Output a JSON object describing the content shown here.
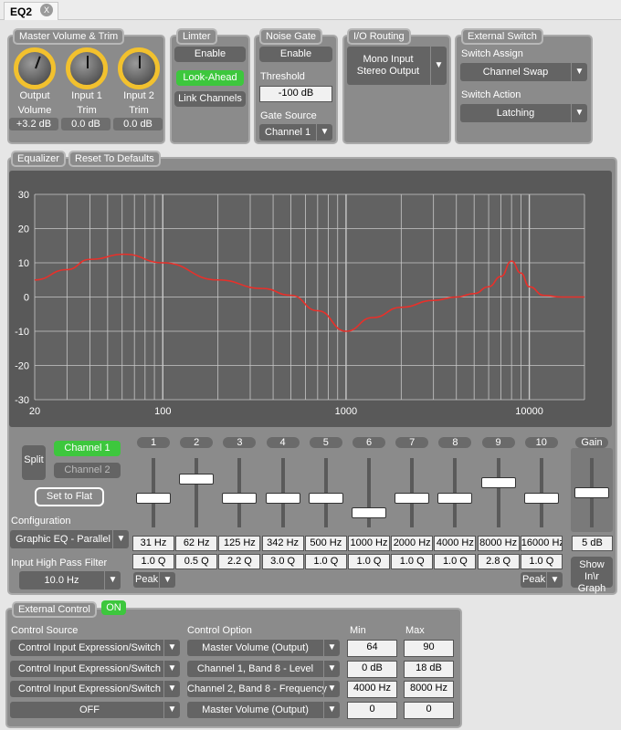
{
  "tab": {
    "title": "EQ2",
    "close": "X"
  },
  "master": {
    "title": "Master Volume & Trim",
    "knobs": [
      {
        "l1": "Output",
        "l2": "Volume",
        "value": "+3.2 dB",
        "angle": 20
      },
      {
        "l1": "Input 1",
        "l2": "Trim",
        "value": "0.0 dB",
        "angle": 0
      },
      {
        "l1": "Input 2",
        "l2": "Trim",
        "value": "0.0 dB",
        "angle": 0
      }
    ]
  },
  "limiter": {
    "title": "Limter",
    "enable": "Enable",
    "lookahead": "Look-Ahead",
    "link": "Link Channels"
  },
  "gate": {
    "title": "Noise Gate",
    "enable": "Enable",
    "threshold_label": "Threshold",
    "threshold": "-100 dB",
    "source_label": "Gate Source",
    "source": "Channel 1"
  },
  "io": {
    "title": "I/O Routing",
    "line1": "Mono Input",
    "line2": "Stereo Output"
  },
  "ext_switch": {
    "title": "External Switch",
    "assign_label": "Switch Assign",
    "assign": "Channel Swap",
    "action_label": "Switch Action",
    "action": "Latching"
  },
  "eq": {
    "title": "Equalizer",
    "reset": "Reset To Defaults",
    "split": "Split",
    "ch1": "Channel 1",
    "ch2": "Channel 2",
    "flat": "Set to Flat",
    "config_label": "Configuration",
    "config": "Graphic EQ - Parallel",
    "hpf_label": "Input High Pass Filter",
    "hpf": "10.0 Hz",
    "gain_label": "Gain",
    "gain": "5 dB",
    "gain_pos": 0.6,
    "show_graph": "Show In\\r Graph",
    "peak": "Peak",
    "bands": [
      {
        "n": "1",
        "f": "31 Hz",
        "q": "1.0 Q",
        "pos": 0.5
      },
      {
        "n": "2",
        "f": "62 Hz",
        "q": "0.5 Q",
        "pos": 0.83
      },
      {
        "n": "3",
        "f": "125 Hz",
        "q": "2.2 Q",
        "pos": 0.5
      },
      {
        "n": "4",
        "f": "342 Hz",
        "q": "3.0 Q",
        "pos": 0.5
      },
      {
        "n": "5",
        "f": "500 Hz",
        "q": "1.0 Q",
        "pos": 0.5
      },
      {
        "n": "6",
        "f": "1000 Hz",
        "q": "1.0 Q",
        "pos": 0.25
      },
      {
        "n": "7",
        "f": "2000 Hz",
        "q": "1.0 Q",
        "pos": 0.5
      },
      {
        "n": "8",
        "f": "4000 Hz",
        "q": "1.0 Q",
        "pos": 0.5
      },
      {
        "n": "9",
        "f": "8000 Hz",
        "q": "2.8 Q",
        "pos": 0.77
      },
      {
        "n": "10",
        "f": "16000 Hz",
        "q": "1.0 Q",
        "pos": 0.5
      }
    ]
  },
  "chart_data": {
    "type": "line",
    "xscale": "log",
    "xlim": [
      20,
      20000
    ],
    "ylim": [
      -30,
      30
    ],
    "grid": true,
    "yticks": [
      "30",
      "20",
      "10",
      "0",
      "-10",
      "-20",
      "-30"
    ],
    "xticks": [
      "20",
      "100",
      "1000",
      "10000"
    ],
    "series": [
      {
        "name": "EQ response",
        "color": "#e8302a",
        "x": [
          20,
          30,
          40,
          62,
          100,
          200,
          350,
          500,
          700,
          1000,
          1400,
          2000,
          3000,
          4000,
          5000,
          6000,
          7000,
          8000,
          9000,
          10000,
          12000,
          15000,
          20000
        ],
        "y": [
          5,
          8,
          11,
          12.5,
          10,
          5,
          2.5,
          0.5,
          -4,
          -10,
          -6,
          -3,
          -1,
          0,
          1,
          3,
          6,
          10.5,
          7,
          3,
          0.5,
          0,
          0
        ]
      }
    ]
  },
  "ext_control": {
    "title": "External Control",
    "on": "ON",
    "source_label": "Control Source",
    "option_label": "Control Option",
    "min_label": "Min",
    "max_label": "Max",
    "rows": [
      {
        "source": "Control Input Expression/Switch",
        "option": "Master Volume (Output)",
        "min": "64",
        "max": "90"
      },
      {
        "source": "Control Input Expression/Switch",
        "option": "Channel 1, Band 8 - Level",
        "min": "0 dB",
        "max": "18 dB"
      },
      {
        "source": "Control Input Expression/Switch",
        "option": "Channel 2, Band 8 - Frequency",
        "min": "4000 Hz",
        "max": "8000 Hz"
      },
      {
        "source": "OFF",
        "option": "Master Volume (Output)",
        "min": "0",
        "max": "0"
      }
    ]
  }
}
